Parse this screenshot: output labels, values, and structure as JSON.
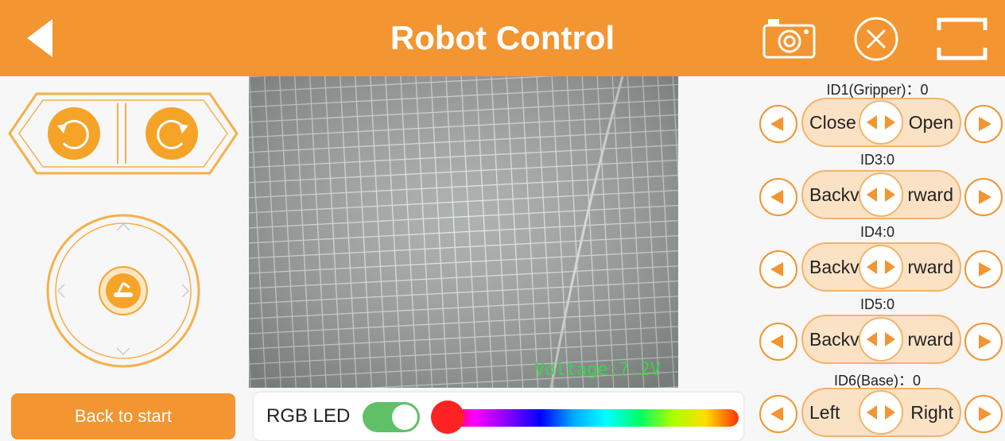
{
  "header": {
    "title": "Robot Control",
    "back_icon": "back-arrow-icon",
    "camera_icon": "camera-icon",
    "close_icon": "close-circle-icon",
    "fullscreen_icon": "fullscreen-icon",
    "color": "#f39530"
  },
  "camera": {
    "voltage": "Voltage:7.2V"
  },
  "left_panel": {
    "rotate_left_icon": "rotate-ccw-icon",
    "rotate_right_icon": "rotate-cw-icon",
    "joystick_icon": "robot-arm-icon",
    "back_to_start": "Back to start"
  },
  "led": {
    "label": "RGB LED",
    "enabled": true,
    "selected_color": "#ff2222"
  },
  "servos": [
    {
      "label": "ID1(Gripper)：0",
      "left": "Close",
      "right": "Open"
    },
    {
      "label": "ID3:0",
      "left": "Backv",
      "right": "rward"
    },
    {
      "label": "ID4:0",
      "left": "Backv",
      "right": "rward"
    },
    {
      "label": "ID5:0",
      "left": "Backv",
      "right": "rward"
    },
    {
      "label": "ID6(Base)：0",
      "left": "Left",
      "right": "Right"
    }
  ]
}
